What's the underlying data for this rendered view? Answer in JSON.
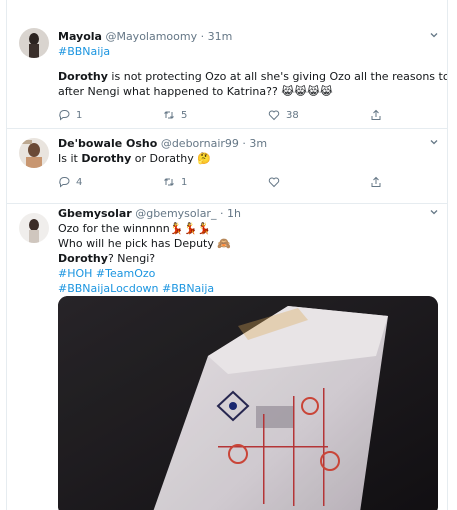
{
  "tweets": [
    {
      "name": "Mayola",
      "handle": "@Mayolamoomy",
      "sep": "·",
      "time": "31m",
      "lines": {
        "l1": "#BBNaija",
        "l2_bold": "Dorothy",
        "l2_rest": " is not protecting Ozo at all she's giving Ozo all  the reasons to go",
        "l3": "after Nengi what happened to Katrina??"
      },
      "emojis": "😹😹😹😹",
      "replies": "1",
      "retweets": "5",
      "likes": "38"
    },
    {
      "name": "De'bowale Osho",
      "handle": "@debornair99",
      "sep": "·",
      "time": "3m",
      "lines": {
        "pre": "Is it ",
        "bold1": "Dorothy",
        "mid": " or Dorathy"
      },
      "emojis": "🤔",
      "replies": "4",
      "retweets": "1",
      "likes": ""
    },
    {
      "name": "Gbemysolar",
      "handle": "@gbemysolar_",
      "sep": "·",
      "time": "1h",
      "lines": {
        "l1": "Ozo for the winnnnn",
        "l1_emoji": "💃💃💃",
        "l2": "Who will he pick has Deputy",
        "l2_emoji": "🙈",
        "l3_bold": "Dorothy",
        "l3_rest": "? Nengi?",
        "l4": "#HOH #TeamOzo",
        "l5": "#BBNaijaLocdown #BBNaija"
      }
    }
  ],
  "icons": [
    "reply-icon",
    "retweet-icon",
    "like-icon",
    "share-icon",
    "chevron-down-icon"
  ],
  "colors": {
    "link": "#1b95e0",
    "muted": "#657786",
    "border": "#e6ecf0"
  }
}
